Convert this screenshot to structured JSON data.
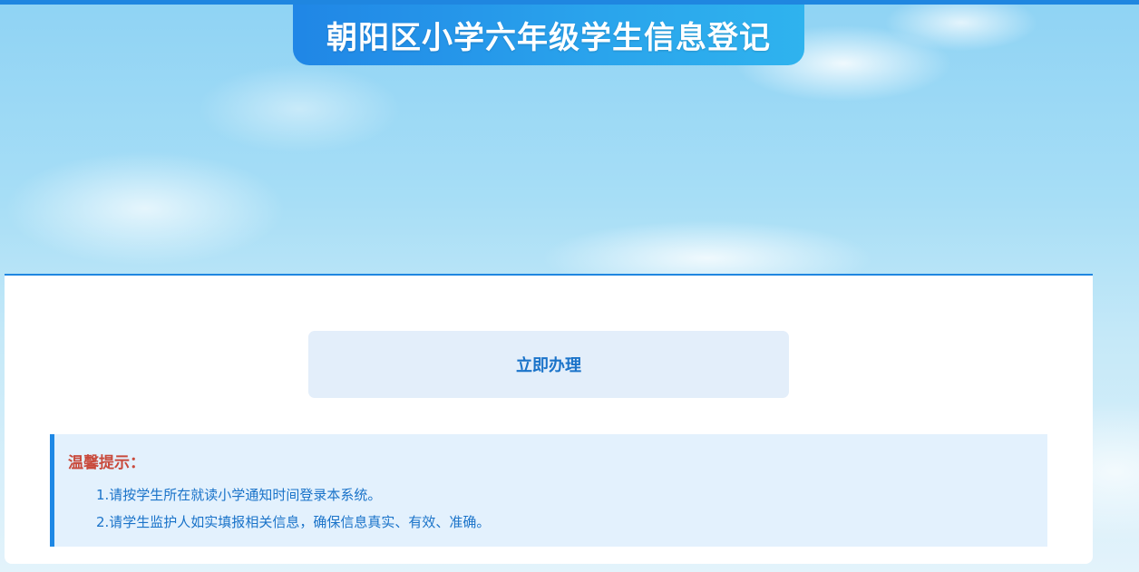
{
  "header": {
    "title": "朝阳区小学六年级学生信息登记"
  },
  "main": {
    "action_button_label": "立即办理"
  },
  "tips": {
    "title": "温馨提示：",
    "items": [
      "1.请按学生所在就读小学通知时间登录本系统。",
      "2.请学生监护人如实填报相关信息，确保信息真实、有效、准确。"
    ]
  },
  "colors": {
    "accent": "#1f86e0",
    "title_banner_start": "#2086e6",
    "title_banner_end": "#2fb3ee",
    "button_bg": "#e3eefa",
    "button_text": "#1a73c9",
    "tips_bg": "#e3f1fd",
    "tips_title": "#c94a3c",
    "tips_text": "#1a73c9"
  }
}
